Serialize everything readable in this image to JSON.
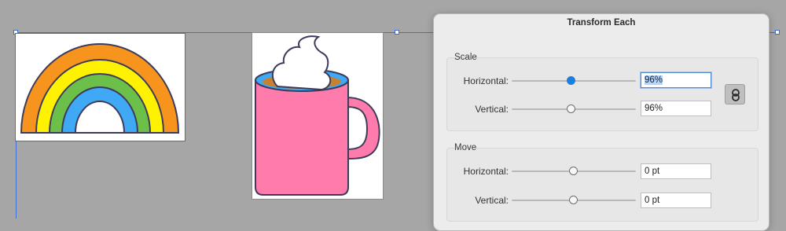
{
  "canvas": {
    "background": "#a6a6a6",
    "selection_color": "#3d6fd6"
  },
  "dialog": {
    "title": "Transform Each",
    "scale": {
      "section_label": "Scale",
      "horizontal": {
        "label": "Horizontal:",
        "value": "96%",
        "slider_percent": 96
      },
      "vertical": {
        "label": "Vertical:",
        "value": "96%",
        "slider_percent": 96
      },
      "constrain_icon": "link-icon"
    },
    "move": {
      "section_label": "Move",
      "horizontal": {
        "label": "Horizontal:",
        "value": "0 pt"
      },
      "vertical": {
        "label": "Vertical:",
        "value": "0 pt"
      }
    }
  },
  "colors": {
    "rainbow_orange": "#f7941d",
    "rainbow_yellow": "#fff200",
    "rainbow_green": "#6cc04a",
    "rainbow_blue": "#3fa9f5",
    "mug_pink": "#ff7bac",
    "coffee": "#c8812f",
    "cup_inner": "#3fa9f5",
    "outline": "#3c3c5a",
    "slider_active": "#1a7fe0"
  }
}
